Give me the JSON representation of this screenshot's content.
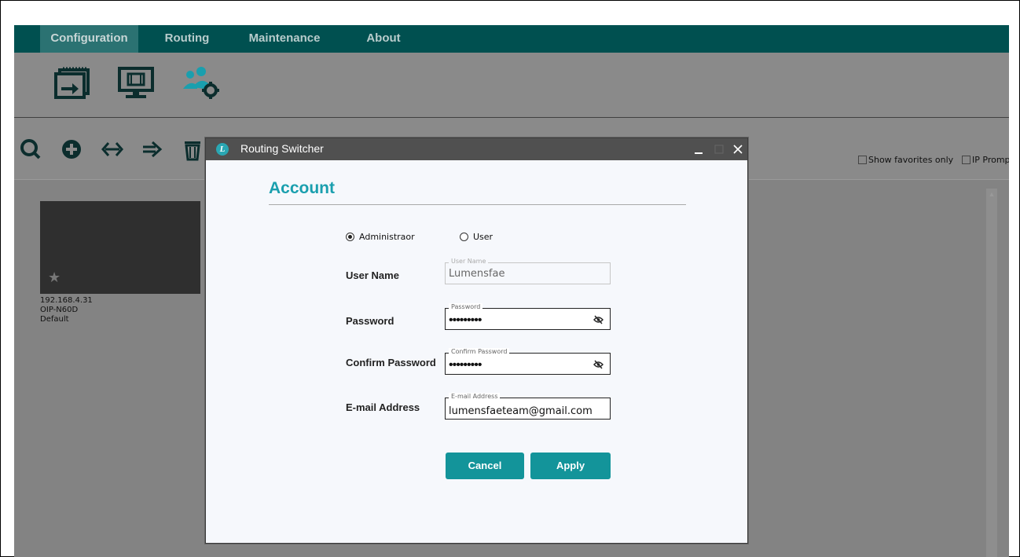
{
  "menu": {
    "items": [
      {
        "label": "Configuration",
        "active": true
      },
      {
        "label": "Routing",
        "active": false
      },
      {
        "label": "Maintenance",
        "active": false
      },
      {
        "label": "About",
        "active": false
      }
    ]
  },
  "config_icons": [
    "video-source-icon",
    "display-monitor-icon",
    "user-settings-icon"
  ],
  "toolbar": {
    "icons": [
      "search-icon",
      "add-icon",
      "swap-arrows-icon",
      "import-arrow-icon",
      "trash-icon"
    ],
    "show_favorites_label": "Show favorites only",
    "ip_prompt_label": "IP Prompt"
  },
  "device": {
    "ip": "192.168.4.31",
    "model": "OIP-N60D",
    "group": "Default",
    "favorite": false
  },
  "dialog": {
    "title": "Routing Switcher",
    "heading": "Account",
    "role_options": [
      {
        "label": "Administraor",
        "selected": true
      },
      {
        "label": "User",
        "selected": false
      }
    ],
    "fields": {
      "username": {
        "label": "User Name",
        "legend": "User Name",
        "value": "Lumensfae"
      },
      "password": {
        "label": "Password",
        "legend": "Password",
        "value": "•••••••••"
      },
      "confirm": {
        "label": "Confirm Password",
        "legend": "Confirm Password",
        "value": "•••••••••"
      },
      "email": {
        "label": "E-mail Address",
        "legend": "E-mail Address",
        "value": "lumensfaeteam@gmail.com"
      }
    },
    "cancel_label": "Cancel",
    "apply_label": "Apply"
  },
  "colors": {
    "menubar": "#005050",
    "accent": "#13949a",
    "heading": "#1a9fae",
    "titlebar": "#505050",
    "overlay": "#8a8a8a"
  }
}
